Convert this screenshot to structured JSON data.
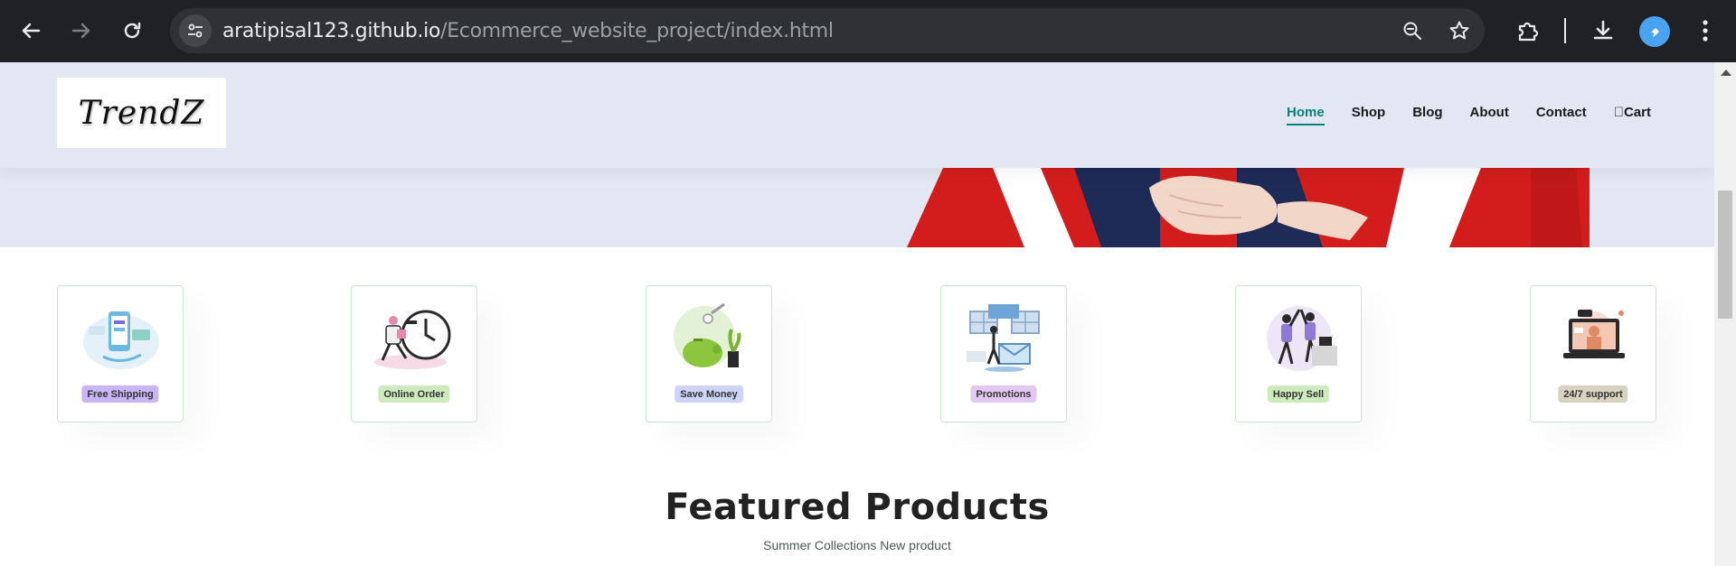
{
  "browser": {
    "url_host": "aratipisal123.github.io",
    "url_path": "/Ecommerce_website_project/index.html"
  },
  "site": {
    "logo": "TrendZ",
    "nav": [
      {
        "label": "Home"
      },
      {
        "label": "Shop"
      },
      {
        "label": "Blog"
      },
      {
        "label": "About"
      },
      {
        "label": "Contact"
      },
      {
        "label": "Cart"
      }
    ]
  },
  "features": [
    {
      "label": "Free Shipping",
      "color": "#c9b5f5"
    },
    {
      "label": "Online Order",
      "color": "#cdebbc"
    },
    {
      "label": "Save Money",
      "color": "#cdd4f8"
    },
    {
      "label": "Promotions",
      "color": "#e3c9f2"
    },
    {
      "label": "Happy Sell",
      "color": "#cdebbc"
    },
    {
      "label": "24/7 support",
      "color": "#d8d2c0"
    }
  ],
  "featured": {
    "title": "Featured Products",
    "subtitle": "Summer Collections New product"
  },
  "colors": {
    "accent": "#088178",
    "header_bg": "#e3e6f3"
  }
}
